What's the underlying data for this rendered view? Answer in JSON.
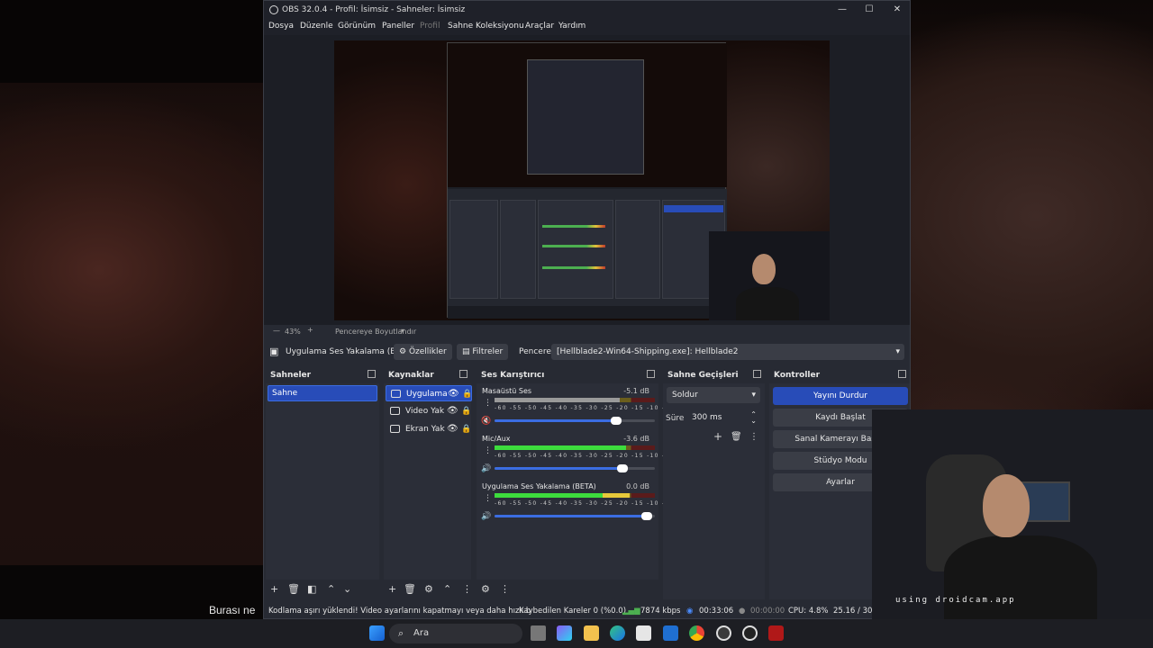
{
  "window": {
    "title": "OBS 32.0.4 - Profil: İsimsiz - Sahneler: İsimsiz",
    "menu": [
      "Dosya",
      "Düzenle",
      "Görünüm",
      "Paneller",
      "Profil",
      "Sahne Koleksiyonu",
      "Araçlar",
      "Yardım"
    ],
    "controls": {
      "minimize": "—",
      "maximize": "☐",
      "close": "✕"
    }
  },
  "preview_bar": {
    "zoom": "43%",
    "scale_mode": "Pencereye Boyutlandır"
  },
  "source_toolbar": {
    "source_name": "Uygulama Ses Yakalama (Bl",
    "properties": "Özellikler",
    "filters": "Filtreler",
    "window_label": "Pencere",
    "window_value": "[Hellblade2-Win64-Shipping.exe]: Hellblade2"
  },
  "scenes": {
    "title": "Sahneler",
    "items": [
      "Sahne"
    ]
  },
  "sources": {
    "title": "Kaynaklar",
    "items": [
      "Uygulama",
      "Video Yak",
      "Ekran Yak"
    ]
  },
  "mixer": {
    "title": "Ses Karıştırıcı",
    "ticks": "-60 -55 -50 -45 -40 -35 -30 -25 -20 -15 -10 -5 0",
    "channels": [
      {
        "name": "Masaüstü Ses",
        "db": "-5.1 dB",
        "level": 0.78,
        "volume": 0.76,
        "muted": true
      },
      {
        "name": "Mic/Aux",
        "db": "-3.6 dB",
        "level": 0.82,
        "volume": 0.8
      },
      {
        "name": "Uygulama Ses Yakalama (BETA)",
        "db": "0.0 dB",
        "level": 0.84,
        "volume": 0.95
      }
    ]
  },
  "transitions": {
    "title": "Sahne Geçişleri",
    "type": "Soldur",
    "duration_label": "Süre",
    "duration": "300 ms"
  },
  "controls": {
    "title": "Kontroller",
    "buttons": [
      "Yayını Durdur",
      "Kaydı Başlat",
      "Sanal Kamerayı Başlat",
      "Stüdyo Modu",
      "Ayarlar"
    ]
  },
  "status": {
    "warning": "Kodlama aşırı yüklendi! Video ayarlarını kapatmayı veya daha hızlı b",
    "dropped": "Kaybedilen Kareler 0 (%0.0)",
    "bitrate": "7874 kbps",
    "stream_time": "00:33:06",
    "record_time": "00:00:00",
    "cpu": "CPU: 4.8%",
    "fps": "25.16 / 30.0"
  },
  "caption": "Burası ne",
  "webcam_overlay": "using droidcam.app",
  "taskbar": {
    "search_placeholder": "Ara"
  },
  "colors": {
    "accent": "#284cb8",
    "panel": "#2b2e38",
    "dark": "#272a33"
  }
}
